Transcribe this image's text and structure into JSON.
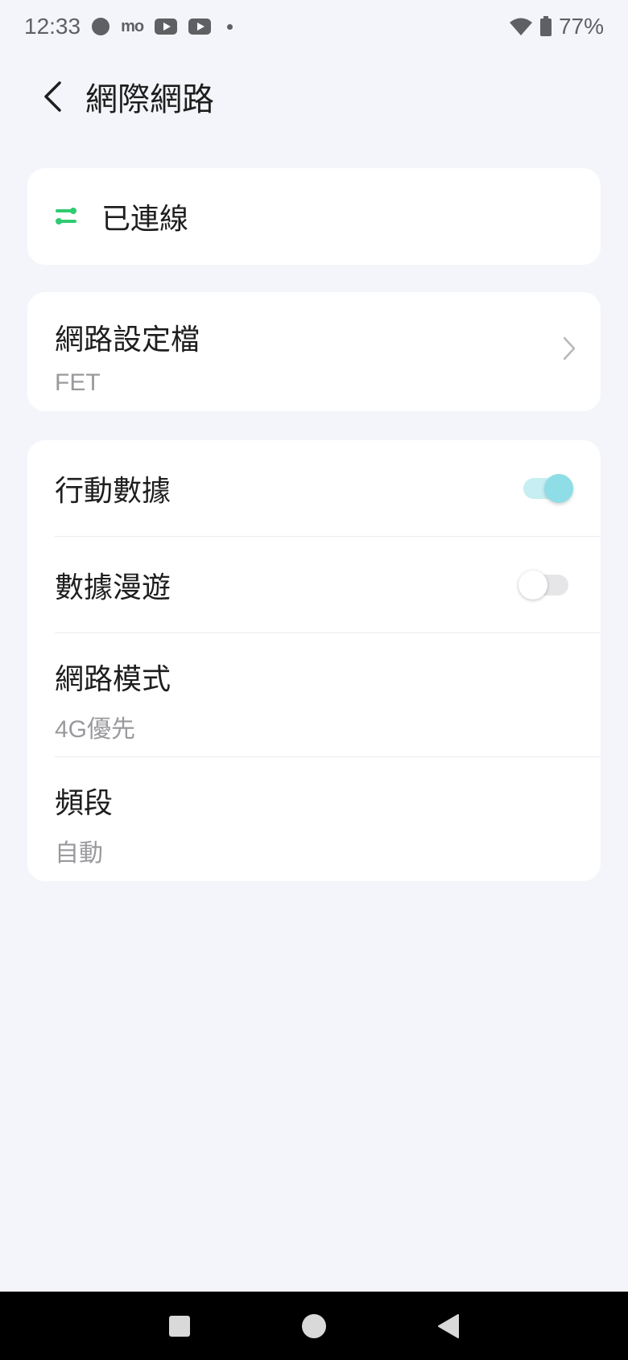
{
  "status_bar": {
    "time": "12:33",
    "mo_label": "mo",
    "battery": "77%"
  },
  "header": {
    "title": "網際網路"
  },
  "connection": {
    "status": "已連線",
    "icon_color": "#2ecc71"
  },
  "profile": {
    "title": "網路設定檔",
    "value": "FET"
  },
  "settings": {
    "mobile_data": {
      "label": "行動數據",
      "enabled": true
    },
    "roaming": {
      "label": "數據漫遊",
      "enabled": false
    },
    "network_mode": {
      "label": "網路模式",
      "value": "4G優先"
    },
    "band": {
      "label": "頻段",
      "value": "自動"
    }
  },
  "colors": {
    "background": "#f4f5fa",
    "card": "#ffffff",
    "toggle_on": "#8fdde6",
    "secondary_text": "#9a9a9e"
  },
  "icons": {
    "back": "chevron-left-icon",
    "connection": "connection-icon",
    "profile_chevron": "chevron-right-icon",
    "nav_recent": "square-icon",
    "nav_home": "circle-icon",
    "nav_back": "triangle-icon"
  }
}
